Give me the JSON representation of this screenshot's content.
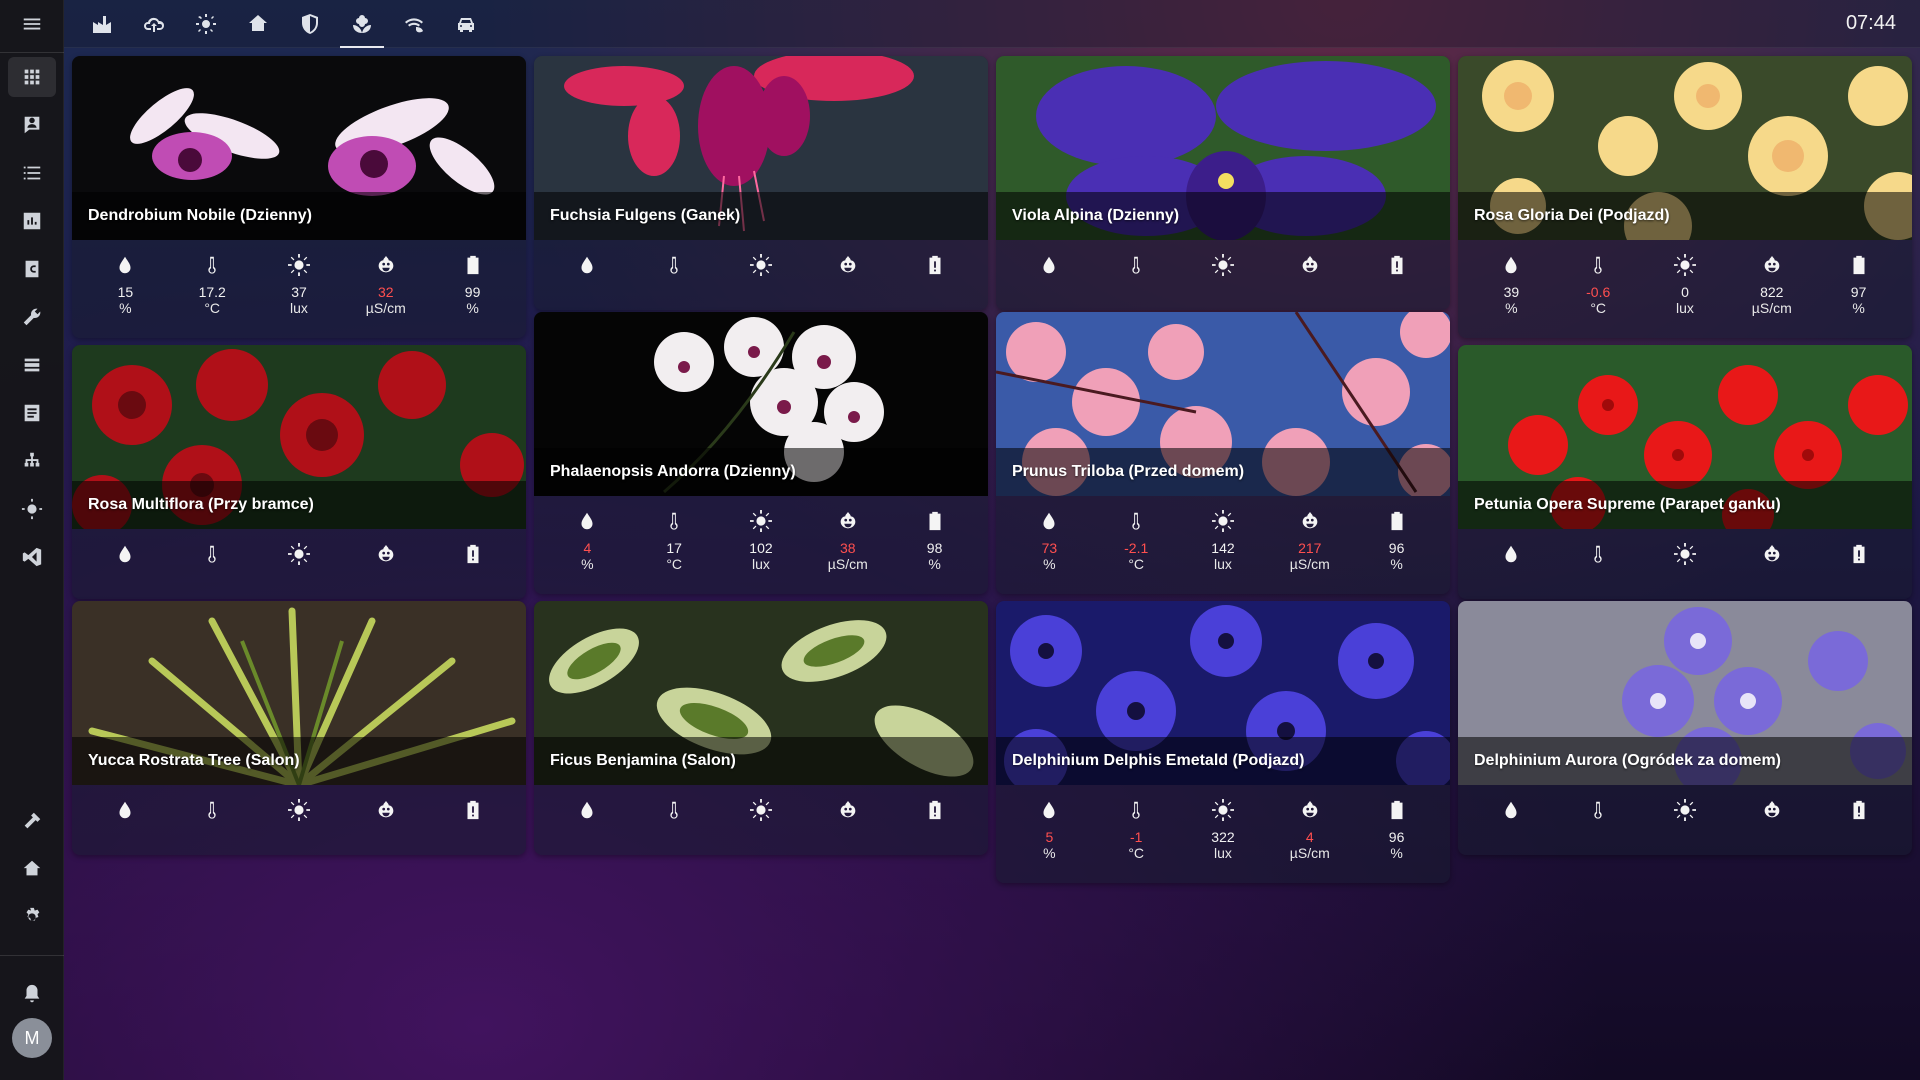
{
  "app": {
    "clock": "07:44",
    "user_initial": "M"
  },
  "sidebar": {
    "items": [
      {
        "name": "menu-icon"
      },
      {
        "name": "overview-grid-icon",
        "active": true
      },
      {
        "name": "map-icon"
      },
      {
        "name": "logbook-icon"
      },
      {
        "name": "history-icon"
      },
      {
        "name": "hacs-icon"
      },
      {
        "name": "wrench-icon"
      },
      {
        "name": "zigbee-icon"
      },
      {
        "name": "log-viewer-icon"
      },
      {
        "name": "node-red-icon"
      },
      {
        "name": "lamp-icon"
      },
      {
        "name": "vscode-icon"
      },
      {
        "name": "developer-tools-icon"
      },
      {
        "name": "home-settings-icon"
      },
      {
        "name": "settings-icon"
      },
      {
        "name": "notifications-icon"
      }
    ]
  },
  "tabs": [
    {
      "name": "factory-icon"
    },
    {
      "name": "weather-cloud-icon"
    },
    {
      "name": "brightness-icon"
    },
    {
      "name": "home-thermometer-icon"
    },
    {
      "name": "shield-icon"
    },
    {
      "name": "flower-icon",
      "active": true
    },
    {
      "name": "wifi-leaf-icon"
    },
    {
      "name": "car-icon"
    }
  ],
  "sensor_icons": [
    "water-drop-icon",
    "thermometer-icon",
    "sun-icon",
    "fertilizer-icon",
    "battery-icon"
  ],
  "plants": [
    {
      "title": "Dendrobium Nobile (Dzienny)",
      "img": "dendrobium",
      "values": [
        {
          "v": "15",
          "u": "%",
          "bad": false
        },
        {
          "v": "17.2",
          "u": "°C",
          "bad": false
        },
        {
          "v": "37",
          "u": "lux",
          "bad": false
        },
        {
          "v": "32",
          "u": "µS/cm",
          "bad": true
        },
        {
          "v": "99",
          "u": "%",
          "bad": false
        }
      ]
    },
    {
      "title": "Fuchsia Fulgens (Ganek)",
      "img": "fuchsia",
      "values": null
    },
    {
      "title": "Viola Alpina (Dzienny)",
      "img": "viola",
      "values": null
    },
    {
      "title": "Rosa Gloria Dei (Podjazd)",
      "img": "rosa-gloria",
      "values": [
        {
          "v": "39",
          "u": "%",
          "bad": false
        },
        {
          "v": "-0.6",
          "u": "°C",
          "bad": true
        },
        {
          "v": "0",
          "u": "lux",
          "bad": false
        },
        {
          "v": "822",
          "u": "µS/cm",
          "bad": false
        },
        {
          "v": "97",
          "u": "%",
          "bad": false
        }
      ]
    },
    {
      "title": "Rosa Multiflora (Przy bramce)",
      "img": "rosa-multiflora",
      "values": null
    },
    {
      "title": "Phalaenopsis Andorra (Dzienny)",
      "img": "phalaenopsis",
      "values": [
        {
          "v": "4",
          "u": "%",
          "bad": true
        },
        {
          "v": "17",
          "u": "°C",
          "bad": false
        },
        {
          "v": "102",
          "u": "lux",
          "bad": false
        },
        {
          "v": "38",
          "u": "µS/cm",
          "bad": true
        },
        {
          "v": "98",
          "u": "%",
          "bad": false
        }
      ]
    },
    {
      "title": "Prunus Triloba (Przed domem)",
      "img": "prunus",
      "values": [
        {
          "v": "73",
          "u": "%",
          "bad": true
        },
        {
          "v": "-2.1",
          "u": "°C",
          "bad": true
        },
        {
          "v": "142",
          "u": "lux",
          "bad": false
        },
        {
          "v": "217",
          "u": "µS/cm",
          "bad": true
        },
        {
          "v": "96",
          "u": "%",
          "bad": false
        }
      ]
    },
    {
      "title": "Petunia Opera Supreme (Parapet ganku)",
      "img": "petunia",
      "values": null
    },
    {
      "title": "Yucca Rostrata Tree (Salon)",
      "img": "yucca",
      "values": null
    },
    {
      "title": "Ficus Benjamina (Salon)",
      "img": "ficus",
      "values": null
    },
    {
      "title": "Delphinium Delphis Emetald (Podjazd)",
      "img": "delphinium-delphis",
      "values": [
        {
          "v": "5",
          "u": "%",
          "bad": true
        },
        {
          "v": "-1",
          "u": "°C",
          "bad": true
        },
        {
          "v": "322",
          "u": "lux",
          "bad": false
        },
        {
          "v": "4",
          "u": "µS/cm",
          "bad": true
        },
        {
          "v": "96",
          "u": "%",
          "bad": false
        }
      ]
    },
    {
      "title": "Delphinium Aurora (Ogródek za domem)",
      "img": "delphinium-aurora",
      "values": null
    }
  ],
  "colors": {
    "warning_value": "#ff4f4f"
  }
}
